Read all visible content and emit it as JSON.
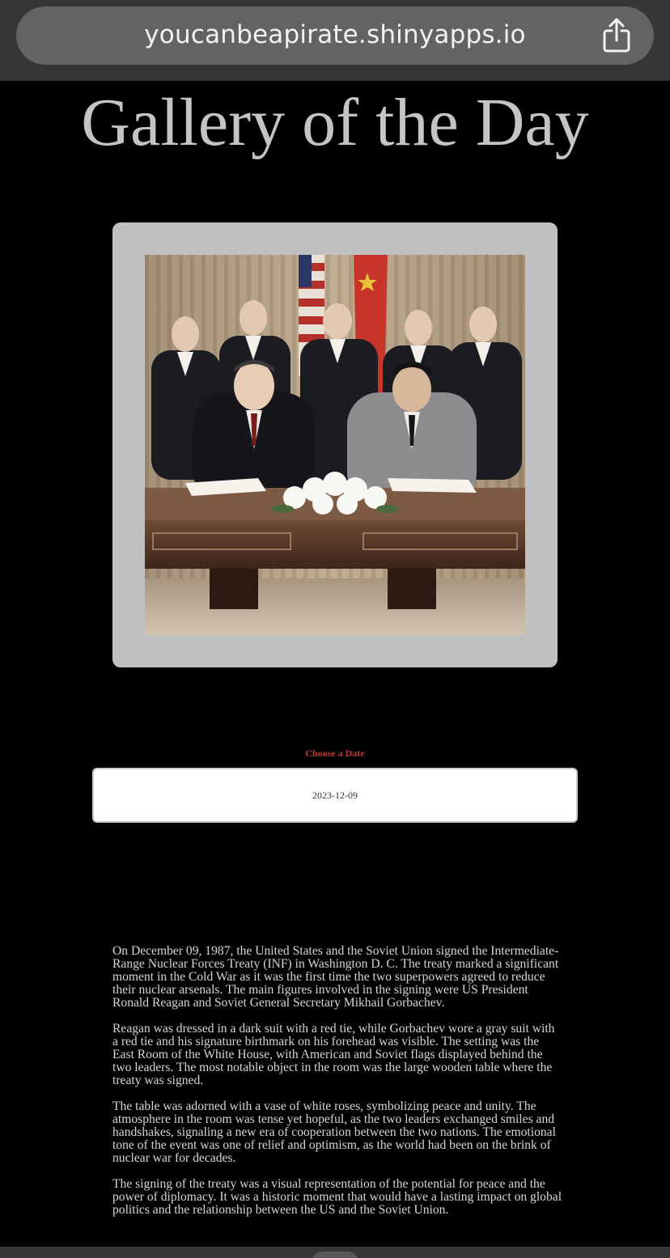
{
  "browser": {
    "url": "youcanbeapirate.shinyapps.io",
    "share_icon": "share-icon"
  },
  "page": {
    "title": "Gallery of the Day"
  },
  "gallery": {
    "image_description_icon": "photo-image"
  },
  "date_picker": {
    "label": "Choose a Date",
    "value": "2023-12-09"
  },
  "story": {
    "paragraphs": [
      "On December 09, 1987, the United States and the Soviet Union signed the Intermediate-Range Nuclear Forces Treaty (INF) in Washington D. C. The treaty marked a significant moment in the Cold War as it was the first time the two superpowers agreed to reduce their nuclear arsenals. The main figures involved in the signing were US President Ronald Reagan and Soviet General Secretary Mikhail Gorbachev.",
      "Reagan was dressed in a dark suit with a red tie, while Gorbachev wore a gray suit with a red tie and his signature birthmark on his forehead was visible. The setting was the East Room of the White House, with American and Soviet flags displayed behind the two leaders. The most notable object in the room was the large wooden table where the treaty was signed.",
      "The table was adorned with a vase of white roses, symbolizing peace and unity. The atmosphere in the room was tense yet hopeful, as the two leaders exchanged smiles and handshakes, signaling a new era of cooperation between the two nations. The emotional tone of the event was one of relief and optimism, as the world had been on the brink of nuclear war for decades.",
      "The signing of the treaty was a visual representation of the potential for peace and the power of diplomacy. It was a historic moment that would have a lasting impact on global politics and the relationship between the US and the Soviet Union."
    ]
  }
}
